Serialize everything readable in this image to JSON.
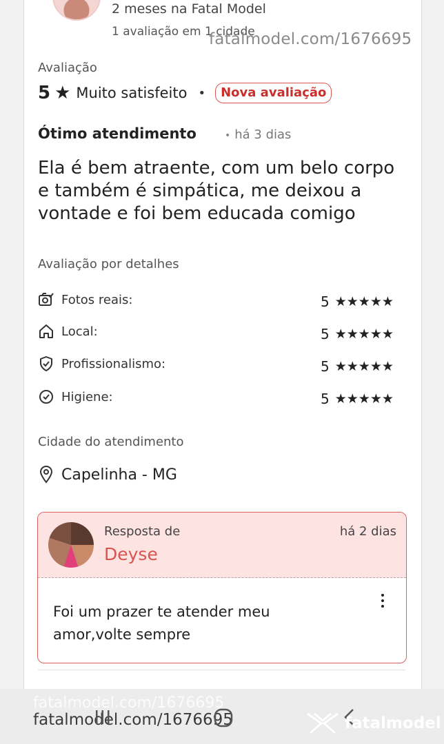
{
  "profile": {
    "time_on_site": "2 meses na Fatal Model",
    "reviews_count": "1 avaliação em 1 cidade"
  },
  "watermark": {
    "top": "fatalmodel.com/1676695",
    "bottom_ghost": "fatalmodel.com/1676695",
    "bottom": "fatalmodel.com/1676695",
    "brand": "fatalmodel"
  },
  "review": {
    "section_label": "Avaliação",
    "score": "5",
    "score_star": "★",
    "score_text": "Muito satisfeito",
    "separator": "•",
    "badge": "Nova avaliação",
    "title": "Ótimo atendimento",
    "age_bullet": "•",
    "age": "há 3 dias",
    "body": "Ela é bem atraente, com um belo corpo e também é simpática, me deixou a vontade e foi bem educada comigo"
  },
  "details": {
    "label": "Avaliação por detalhes",
    "stars": "★★★★★",
    "items": [
      {
        "label": "Fotos reais:",
        "score": "5",
        "icon": "camera-check-icon"
      },
      {
        "label": "Local:",
        "score": "5",
        "icon": "home-icon"
      },
      {
        "label": "Profissionalismo:",
        "score": "5",
        "icon": "shield-check-icon"
      },
      {
        "label": "Higiene:",
        "score": "5",
        "icon": "check-circle-icon"
      }
    ]
  },
  "city": {
    "label": "Cidade do atendimento",
    "value": "Capelinha - MG",
    "icon": "map-pin-icon"
  },
  "reply": {
    "by_label": "Resposta de",
    "name": "Deyse",
    "age": "há 2 dias",
    "text": "Foi um prazer te atender meu amor,volte sempre"
  },
  "colors": {
    "accent": "#d9534f",
    "reply_bg": "#fde3e2"
  }
}
